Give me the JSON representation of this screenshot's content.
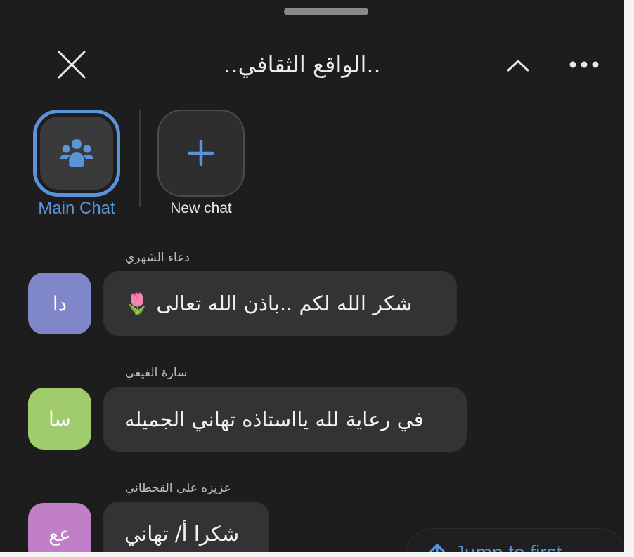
{
  "header": {
    "title": "..الواقع الثقافي..",
    "close_icon": "close-icon",
    "collapse_icon": "chevron-up-icon",
    "more_icon": "more-horizontal-icon"
  },
  "chat_switcher": {
    "main_chat_label": "Main Chat",
    "main_chat_icon": "group-icon",
    "new_chat_label": "New chat",
    "new_chat_icon": "plus-icon"
  },
  "messages": [
    {
      "sender": "دعاء الشهري",
      "initials": "دا",
      "avatar_color": "#7f86c9",
      "text": "شكر الله لكم ..باذن الله تعالى 🌷"
    },
    {
      "sender": "سارة الفيفي",
      "initials": "سا",
      "avatar_color": "#a1cc6e",
      "text": "في رعاية لله يااستاذه تهاني الجميله"
    },
    {
      "sender": "عزيزه علي القحطاني",
      "initials": "عع",
      "avatar_color": "#c07fc6",
      "text": "شكرا أ/ تهاني"
    }
  ],
  "jump": {
    "label": "Jump to first",
    "icon": "arrow-up-icon"
  },
  "colors": {
    "accent": "#5b93d9",
    "background": "#1d1d1d",
    "bubble": "#333335"
  }
}
